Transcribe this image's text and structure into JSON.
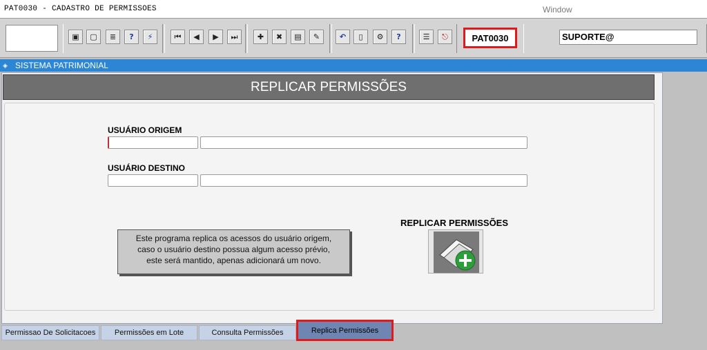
{
  "titlebar": {
    "title": "PAT0030 - CADASTRO DE PERMISSOES",
    "window_menu": "Window"
  },
  "toolbar": {
    "program_code": "PAT0030",
    "user": "SUPORTE@",
    "icons": [
      "save-icon",
      "print-preview-icon",
      "print-icon",
      "query-help-icon",
      "execute-query-icon",
      "first-record-icon",
      "previous-record-icon",
      "next-record-icon",
      "last-record-icon",
      "insert-record-icon",
      "delete-record-icon",
      "clear-form-icon",
      "edit-icon",
      "undo-icon",
      "paste-icon",
      "settings-icon",
      "help-icon",
      "menu-icon",
      "exit-icon"
    ]
  },
  "system_bar": {
    "label": "SISTEMA PATRIMONIAL"
  },
  "form": {
    "header": "REPLICAR PERMISSÕES",
    "origem_label": "USUÁRIO ORIGEM",
    "destino_label": "USUÁRIO DESTINO",
    "origem_code": "",
    "origem_name": "",
    "destino_code": "",
    "destino_name": "",
    "info_line1": "Este programa replica os acessos do usuário origem,",
    "info_line2": "caso o usuário destino possua algum acesso prévio,",
    "info_line3": "este será mantido, apenas adicionará um novo.",
    "replicar_label": "REPLICAR PERMISSÕES"
  },
  "tabs": [
    {
      "label": "Permissao De Solicitacoes",
      "active": false
    },
    {
      "label": "Permissões em Lote",
      "active": false
    },
    {
      "label": "Consulta Permissões",
      "active": false
    },
    {
      "label": "Replica Permissões",
      "active": true
    }
  ],
  "colors": {
    "accent_blue": "#2c86d4",
    "highlight_red": "#e01a1a",
    "header_gray": "#6f6f6f",
    "active_tab": "#6f86b3"
  }
}
